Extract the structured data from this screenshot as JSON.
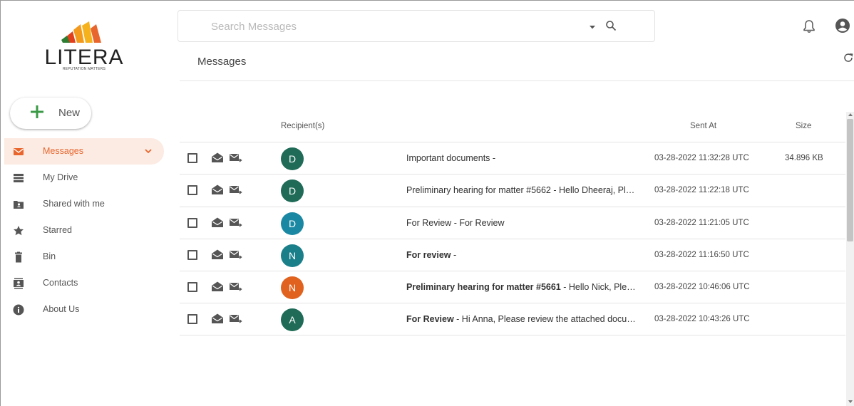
{
  "logo": {
    "name": "LITERA",
    "tagline": "REPUTATION MATTERS"
  },
  "search": {
    "placeholder": "Search Messages",
    "value": ""
  },
  "header": {
    "title": "Messages"
  },
  "new_button": {
    "label": "New"
  },
  "sidebar": {
    "items": [
      {
        "label": "Messages",
        "icon": "mail-icon",
        "active": true
      },
      {
        "label": "My Drive",
        "icon": "list-icon",
        "active": false
      },
      {
        "label": "Shared with me",
        "icon": "shared-folder-icon",
        "active": false
      },
      {
        "label": "Starred",
        "icon": "star-icon",
        "active": false
      },
      {
        "label": "Bin",
        "icon": "trash-icon",
        "active": false
      },
      {
        "label": "Contacts",
        "icon": "contacts-icon",
        "active": false
      },
      {
        "label": "About Us",
        "icon": "info-icon",
        "active": false
      }
    ]
  },
  "table": {
    "columns": {
      "recipients": "Recipient(s)",
      "sent_at": "Sent At",
      "size": "Size"
    },
    "rows": [
      {
        "avatar": "D",
        "avatar_color": "#1f6b57",
        "subject": "Important documents",
        "preview": " -",
        "sent_at": "03-28-2022 11:32:28 UTC",
        "size": "34.896 KB",
        "unread": false
      },
      {
        "avatar": "D",
        "avatar_color": "#1f6b57",
        "subject": "Preliminary hearing for matter #5662",
        "preview": " - Hello Dheeraj, Please review the attached documents",
        "sent_at": "03-28-2022 11:22:18 UTC",
        "size": "",
        "unread": false
      },
      {
        "avatar": "D",
        "avatar_color": "#1b88a3",
        "subject": "For Review",
        "preview": " - For Review",
        "sent_at": "03-28-2022 11:21:05 UTC",
        "size": "",
        "unread": false
      },
      {
        "avatar": "N",
        "avatar_color": "#1b7f8a",
        "subject": "For   review",
        "preview": " -",
        "sent_at": "03-28-2022 11:16:50 UTC",
        "size": "",
        "unread": true
      },
      {
        "avatar": "N",
        "avatar_color": "#e0621e",
        "subject": "Preliminary hearing for matter #5661",
        "preview": " - Hello Nick, Please review the attached documents",
        "sent_at": "03-28-2022 10:46:06 UTC",
        "size": "",
        "unread": true
      },
      {
        "avatar": "A",
        "avatar_color": "#1f6b57",
        "subject": "For Review",
        "preview": " - Hi Anna, Please review the attached documents",
        "sent_at": "03-28-2022 10:43:26 UTC",
        "size": "",
        "unread": true
      }
    ]
  },
  "colors": {
    "accent": "#e8662d",
    "active_bg": "#fcebe3"
  }
}
